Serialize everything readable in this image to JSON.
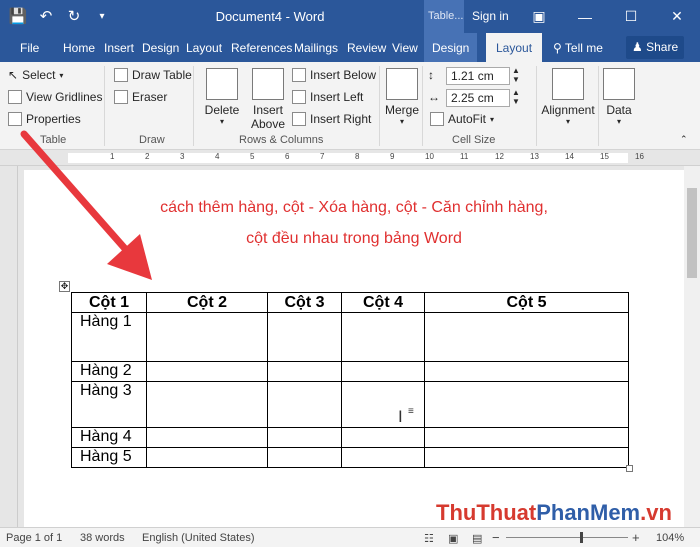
{
  "titlebar": {
    "title": "Document4 - Word",
    "table_tools": "Table...",
    "sign_in": "Sign in"
  },
  "tabs": {
    "file": "File",
    "home": "Home",
    "insert": "Insert",
    "design": "Design",
    "layout": "Layout",
    "references": "References",
    "mailings": "Mailings",
    "review": "Review",
    "view": "View",
    "table_design": "Design",
    "table_layout": "Layout",
    "tell_me": "Tell me",
    "share": "Share"
  },
  "ribbon": {
    "table_group": {
      "select": "Select",
      "view_gridlines": "View Gridlines",
      "properties": "Properties",
      "label": "Table"
    },
    "draw_group": {
      "draw_table": "Draw Table",
      "eraser": "Eraser",
      "label": "Draw"
    },
    "rows_cols_group": {
      "delete": "Delete",
      "insert_above_1": "Insert",
      "insert_above_2": "Above",
      "insert_below": "Insert Below",
      "insert_left": "Insert Left",
      "insert_right": "Insert Right",
      "label": "Rows & Columns"
    },
    "merge_group": {
      "merge": "Merge"
    },
    "cell_size_group": {
      "height": "1.21 cm",
      "width": "2.25 cm",
      "autofit": "AutoFit",
      "label": "Cell Size"
    },
    "alignment": "Alignment",
    "data": "Data"
  },
  "ruler": {
    "ticks": [
      "1",
      "2",
      "3",
      "4",
      "5",
      "6",
      "7",
      "8",
      "9",
      "10",
      "11",
      "12",
      "13",
      "14",
      "15",
      "16"
    ]
  },
  "document": {
    "heading_line1": "cách thêm hàng, cột - Xóa hàng, cột - Căn chỉnh hàng,",
    "heading_line2": "cột đều nhau trong bảng Word",
    "table": {
      "headers": [
        "Cột 1",
        "Cột 2",
        "Cột 3",
        "Cột 4",
        "Cột 5"
      ],
      "rows": [
        "Hàng 1",
        "Hàng 2",
        "Hàng 3",
        "Hàng 4",
        "Hàng 5"
      ]
    }
  },
  "status": {
    "page": "Page 1 of 1",
    "words": "38 words",
    "language": "English (United States)",
    "zoom": "104%"
  },
  "watermark": {
    "part1": "ThuThuat",
    "part2": "PhanMem",
    "part3": ".vn"
  },
  "colors": {
    "word_blue": "#2b579a",
    "heading_red": "#e03030",
    "arrow_red": "#e8383d"
  }
}
